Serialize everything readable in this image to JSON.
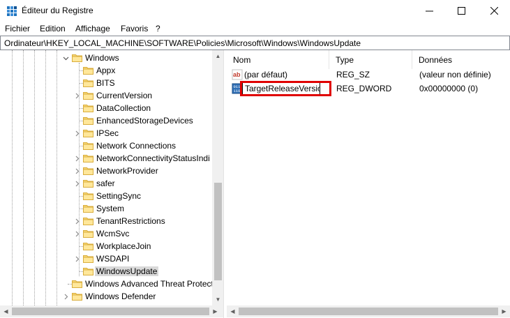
{
  "window": {
    "title": "Éditeur du Registre",
    "minimize_glyph": "—",
    "maximize_glyph": "☐",
    "close_glyph": "✕"
  },
  "menu": {
    "items": [
      "Fichier",
      "Edition",
      "Affichage",
      "Favoris",
      "?"
    ]
  },
  "address": {
    "path": "Ordinateur\\HKEY_LOCAL_MACHINE\\SOFTWARE\\Policies\\Microsoft\\Windows\\WindowsUpdate"
  },
  "tree": {
    "items": [
      {
        "label": "Windows",
        "expandable": true,
        "expanded": true,
        "selected": false
      },
      {
        "label": "Appx",
        "expandable": false,
        "selected": false
      },
      {
        "label": "BITS",
        "expandable": false,
        "selected": false
      },
      {
        "label": "CurrentVersion",
        "expandable": true,
        "selected": false
      },
      {
        "label": "DataCollection",
        "expandable": false,
        "selected": false
      },
      {
        "label": "EnhancedStorageDevices",
        "expandable": false,
        "selected": false
      },
      {
        "label": "IPSec",
        "expandable": true,
        "selected": false
      },
      {
        "label": "Network Connections",
        "expandable": false,
        "selected": false
      },
      {
        "label": "NetworkConnectivityStatusIndi",
        "expandable": true,
        "selected": false
      },
      {
        "label": "NetworkProvider",
        "expandable": true,
        "selected": false
      },
      {
        "label": "safer",
        "expandable": true,
        "selected": false
      },
      {
        "label": "SettingSync",
        "expandable": false,
        "selected": false
      },
      {
        "label": "System",
        "expandable": false,
        "selected": false
      },
      {
        "label": "TenantRestrictions",
        "expandable": true,
        "selected": false
      },
      {
        "label": "WcmSvc",
        "expandable": true,
        "selected": false
      },
      {
        "label": "WorkplaceJoin",
        "expandable": false,
        "selected": false
      },
      {
        "label": "WSDAPI",
        "expandable": true,
        "selected": false
      },
      {
        "label": "WindowsUpdate",
        "expandable": false,
        "selected": true
      },
      {
        "label": "Windows Advanced Threat Protect",
        "expandable": false,
        "selected": false
      },
      {
        "label": "Windows Defender",
        "expandable": true,
        "selected": false
      }
    ]
  },
  "values": {
    "columns": [
      "Nom",
      "Type",
      "Données"
    ],
    "rows": [
      {
        "name": "(par défaut)",
        "type": "REG_SZ",
        "data": "(valeur non définie)",
        "icon": "string-value-icon"
      },
      {
        "name": "TargetReleaseVersion",
        "type": "REG_DWORD",
        "data": "0x00000000 (0)",
        "icon": "dword-value-icon",
        "editing": true
      }
    ]
  },
  "colors": {
    "highlight": "#e00000",
    "folder": "#f8d775",
    "selection": "#d9d9d9"
  }
}
